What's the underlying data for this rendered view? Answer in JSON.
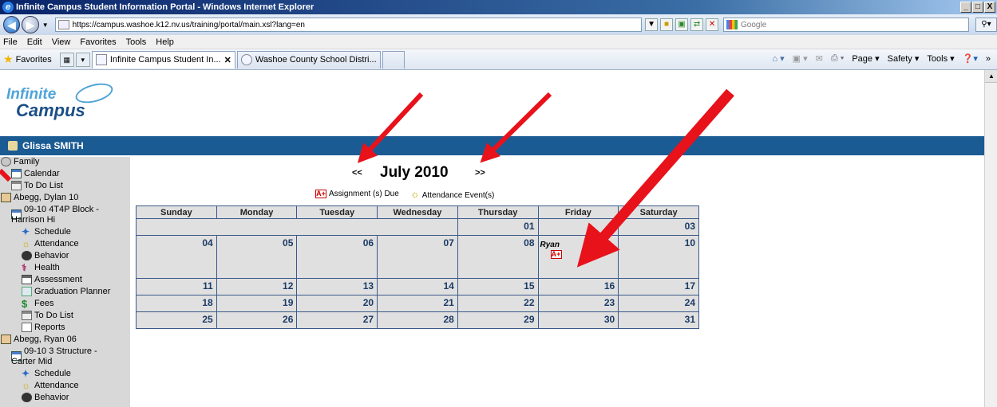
{
  "window": {
    "title": "Infinite Campus Student Information Portal - Windows Internet Explorer",
    "controls": [
      "_",
      "□",
      "X"
    ]
  },
  "address_bar": {
    "url": "https://campus.washoe.k12.nv.us/training/portal/main.xsl?lang=en",
    "search_placeholder": "Google"
  },
  "menu": [
    "File",
    "Edit",
    "View",
    "Favorites",
    "Tools",
    "Help"
  ],
  "favorites_label": "Favorites",
  "tabs": [
    {
      "label": "Infinite Campus Student In...",
      "active": true
    },
    {
      "label": "Washoe County School Distri...",
      "active": false
    }
  ],
  "command_bar": [
    "Page ▾",
    "Safety ▾",
    "Tools ▾"
  ],
  "logo": {
    "line1": "Infinite",
    "line2": "Campus"
  },
  "user": "Glissa SMITH",
  "sidebar": {
    "family": "Family",
    "calendar": "Calendar",
    "todo": "To Do List",
    "student1": {
      "name": "Abegg, Dylan 10",
      "school_line1": "09-10 4T4P Block -",
      "school_line2": "Harrison Hi",
      "items": [
        "Schedule",
        "Attendance",
        "Behavior",
        "Health",
        "Assessment",
        "Graduation Planner",
        "Fees",
        "To Do List",
        "Reports"
      ]
    },
    "student2": {
      "name": "Abegg, Ryan 06",
      "school_line1": "09-10 3 Structure -",
      "school_line2": "Carter Mid",
      "items": [
        "Schedule",
        "Attendance",
        "Behavior"
      ]
    }
  },
  "calendar": {
    "prev": "<<",
    "next": ">>",
    "month": "July 2010",
    "legend": {
      "assignment": "Assignment (s) Due",
      "attendance": "Attendance Event(s)"
    },
    "days": [
      "Sunday",
      "Monday",
      "Tuesday",
      "Wednesday",
      "Thursday",
      "Friday",
      "Saturday"
    ],
    "weeks": [
      [
        "",
        "",
        "",
        "",
        "01",
        "",
        "03"
      ],
      [
        "04",
        "05",
        "06",
        "07",
        "08",
        "",
        "10"
      ],
      [
        "11",
        "12",
        "13",
        "14",
        "15",
        "16",
        "17"
      ],
      [
        "18",
        "19",
        "20",
        "21",
        "22",
        "23",
        "24"
      ],
      [
        "25",
        "26",
        "27",
        "28",
        "29",
        "30",
        "31"
      ]
    ],
    "event": {
      "name": "Ryan",
      "icon": "A+"
    }
  },
  "colors": {
    "header_blue": "#1b5b93",
    "arrow_red": "#e8121b",
    "cell_bg": "#e0e0e0"
  }
}
